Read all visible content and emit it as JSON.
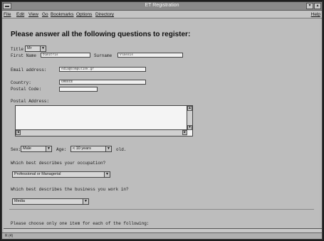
{
  "window": {
    "title": "ET Registration"
  },
  "menu": [
    "File",
    "Edit",
    "View",
    "Go",
    "Bookmarks",
    "Options",
    "Directory"
  ],
  "menu_help": "Help",
  "heading": "Please answer all the following questions to register:",
  "form": {
    "title_label": "Title",
    "title_value": "Mr",
    "first_name_label": "First Name",
    "first_name_value": "Dimitris",
    "surname_label": "Surname",
    "surname_value": "Vlassis",
    "email_label": "Email address:",
    "email_value": "edia@compulink.gr",
    "country_label": "Country:",
    "country_value": "GREECE",
    "postal_code_label": "Postal Code:",
    "postal_code_value": "",
    "postal_address_label": "Postal Address:",
    "sex_label": "Sex:",
    "sex_value": "Male",
    "age_label": "Age:",
    "age_value": "< 10 years",
    "age_suffix": "old.",
    "occupation_question": "Which best describes your occupation?",
    "occupation_value": "Professional or Managerial",
    "business_question": "Which best describes the business you work in?",
    "business_value": "Media",
    "tick_instruction": "Please choose only one item for each of the following:"
  },
  "status": {
    "text": "R (4)"
  },
  "icons": {
    "system_menu": "system-menu-icon",
    "minimize": "minimize-icon",
    "dropdown": "chevron-down-icon",
    "scroll_up": "arrow-up-icon",
    "scroll_down": "arrow-down-icon",
    "scroll_left": "arrow-left-icon",
    "scroll_right": "arrow-right-icon"
  }
}
